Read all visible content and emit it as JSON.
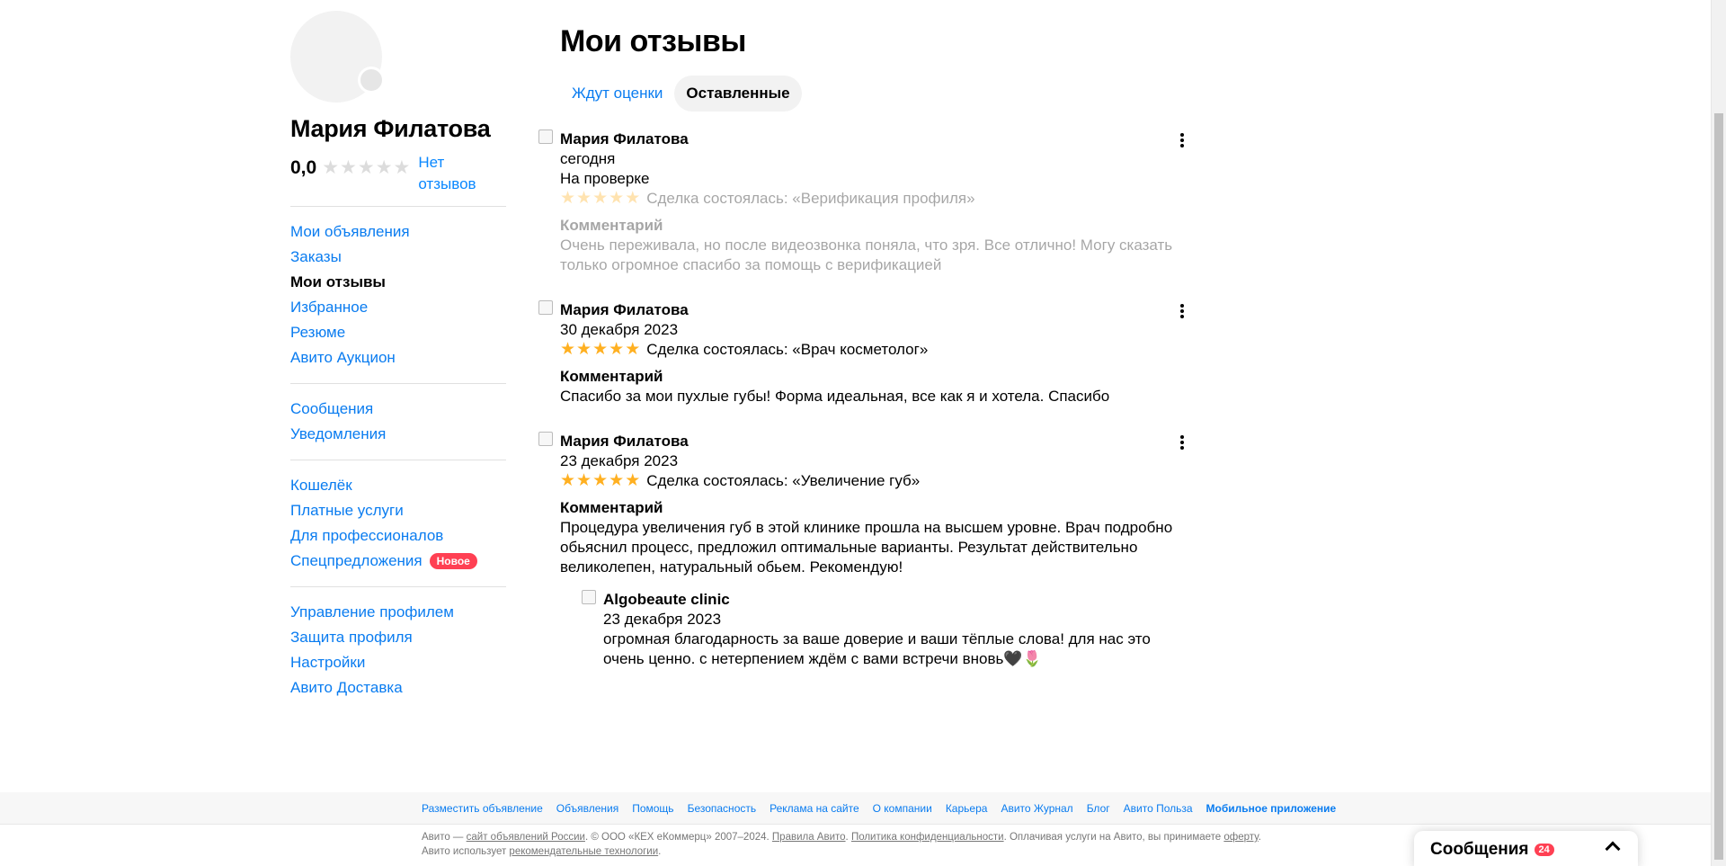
{
  "sidebar": {
    "name": "Мария Филатова",
    "rating_value": "0,0",
    "no_reviews": "Нет отзывов",
    "groups": [
      [
        {
          "label": "Мои объявления",
          "active": false
        },
        {
          "label": "Заказы",
          "active": false
        },
        {
          "label": "Мои отзывы",
          "active": true
        },
        {
          "label": "Избранное",
          "active": false
        },
        {
          "label": "Резюме",
          "active": false
        },
        {
          "label": "Авито Аукцион",
          "active": false
        }
      ],
      [
        {
          "label": "Сообщения",
          "active": false
        },
        {
          "label": "Уведомления",
          "active": false
        }
      ],
      [
        {
          "label": "Кошелёк",
          "active": false
        },
        {
          "label": "Платные услуги",
          "active": false
        },
        {
          "label": "Для профессионалов",
          "active": false
        },
        {
          "label": "Спецпредложения",
          "active": false,
          "badge": "Новое"
        }
      ],
      [
        {
          "label": "Управление профилем",
          "active": false
        },
        {
          "label": "Защита профиля",
          "active": false
        },
        {
          "label": "Настройки",
          "active": false
        },
        {
          "label": "Авито Доставка",
          "active": false
        }
      ]
    ]
  },
  "main": {
    "title": "Мои отзывы",
    "tabs": [
      {
        "label": "Ждут оценки",
        "active": false
      },
      {
        "label": "Оставленные",
        "active": true
      }
    ],
    "comment_label": "Комментарий",
    "reviews": [
      {
        "author": "Мария Филатова",
        "date": "сегодня",
        "status": "На проверке",
        "stars": 5,
        "deal": "Сделка состоялась: «Верификация профиля»",
        "comment": "Очень переживала, но после видеозвонка поняла, что зря. Все отлично! Могу сказать только огромное спасибо за помощь с верификацией",
        "pending": true
      },
      {
        "author": "Мария Филатова",
        "date": "30 декабря 2023",
        "stars": 5,
        "deal": "Сделка состоялась: «Врач косметолог»",
        "comment": "Спасибо за мои пухлые губы! Форма идеальная, все как я и хотела. Спасибо"
      },
      {
        "author": "Мария Филатова",
        "date": "23 декабря 2023",
        "stars": 5,
        "deal": "Сделка состоялась: «Увеличение губ»",
        "comment": "Процедура увеличения губ в этой клинике прошла на высшем уровне. Врач подробно обьяснил процесс, предложил оптимальные варианты. Результат действительно великолепен, натуральный обьем. Рекомендую!",
        "reply": {
          "author": "Algobeaute clinic",
          "date": "23 декабря 2023",
          "text": "огромная благодарность за ваше доверие и ваши тёплые слова! для нас это очень ценно. с нетерпением ждём с вами встречи вновь🖤🌷"
        }
      }
    ]
  },
  "footer": {
    "links": [
      {
        "label": "Разместить объявление"
      },
      {
        "label": "Объявления"
      },
      {
        "label": "Помощь"
      },
      {
        "label": "Безопасность"
      },
      {
        "label": "Реклама на сайте"
      },
      {
        "label": "О компании"
      },
      {
        "label": "Карьера"
      },
      {
        "label": "Авито Журнал"
      },
      {
        "label": "Блог"
      },
      {
        "label": "Авито Польза"
      },
      {
        "label": "Мобильное приложение",
        "bold": true
      }
    ],
    "legal": {
      "p1": "Авито — ",
      "l1": "сайт объявлений России",
      "p2": ". © ООО «КЕХ еКоммерц» 2007–2024. ",
      "l2": "Правила Авито",
      "p3": ". ",
      "l3": "Политика конфиденциальности",
      "p4": ". Оплачивая услуги на Авито, вы принимаете ",
      "l4": "оферту",
      "p5": ". Авито использует ",
      "l5": "рекомендательные технологии",
      "p6": "."
    }
  },
  "messages_widget": {
    "title": "Сообщения",
    "count": "24"
  },
  "colors": {
    "link": "#0a7cf0",
    "star": "#ffb021",
    "badge": "#ff4053"
  }
}
